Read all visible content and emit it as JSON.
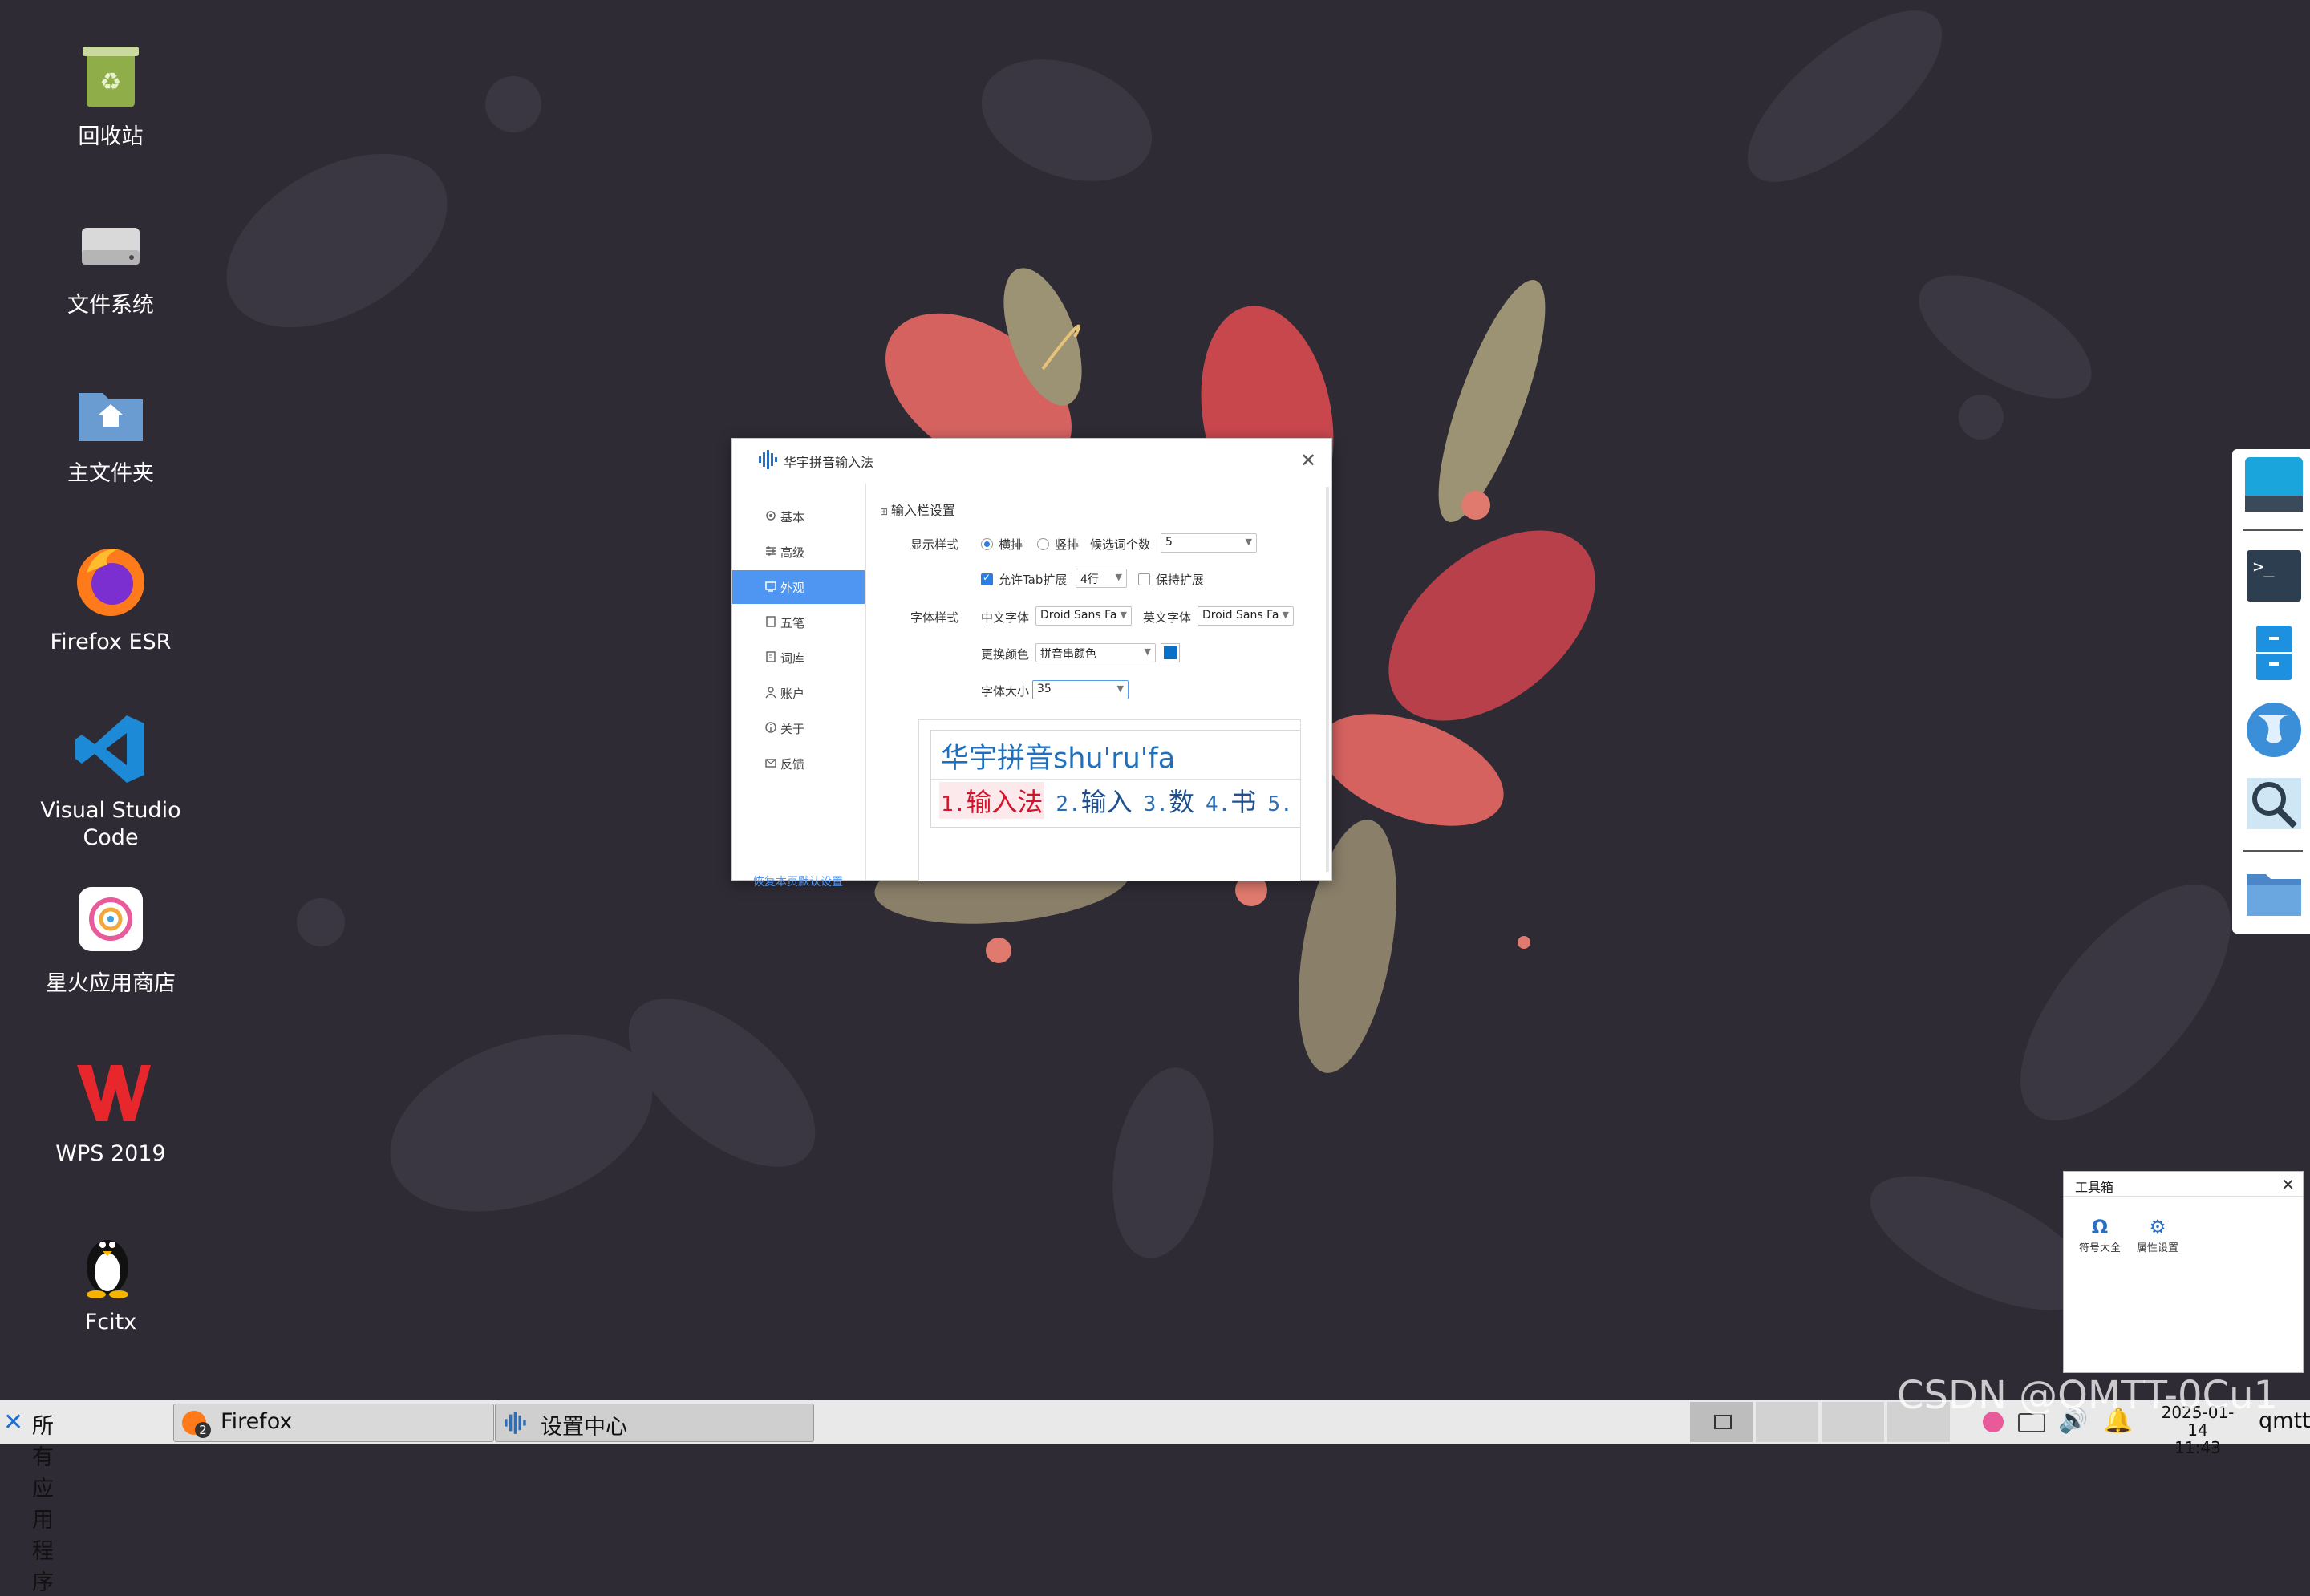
{
  "desktop": {
    "icons": [
      {
        "label": "回收站",
        "icon": "recycle-bin-icon"
      },
      {
        "label": "文件系统",
        "icon": "drive-icon"
      },
      {
        "label": "主文件夹",
        "icon": "home-folder-icon"
      },
      {
        "label": "Firefox ESR",
        "icon": "firefox-icon"
      },
      {
        "label": "Visual Studio Code",
        "icon": "vscode-icon"
      },
      {
        "label": "星火应用商店",
        "icon": "app-store-icon"
      },
      {
        "label": "WPS 2019",
        "icon": "wps-icon"
      },
      {
        "label": "Fcitx",
        "icon": "tux-icon"
      }
    ]
  },
  "dialog": {
    "title": "华宇拼音输入法",
    "close": "✕",
    "sidebar": {
      "items": [
        {
          "label": "基本",
          "icon": "gear-icon"
        },
        {
          "label": "高级",
          "icon": "sliders-icon"
        },
        {
          "label": "外观",
          "icon": "palette-icon",
          "active": true
        },
        {
          "label": "五笔",
          "icon": "pen-icon"
        },
        {
          "label": "词库",
          "icon": "book-icon"
        },
        {
          "label": "账户",
          "icon": "user-icon"
        },
        {
          "label": "关于",
          "icon": "info-icon"
        },
        {
          "label": "反馈",
          "icon": "mail-icon"
        }
      ],
      "reset": "恢复本页默认设置"
    },
    "section_title": "输入栏设置",
    "display_style": {
      "label": "显示样式",
      "horizontal": "横排",
      "vertical": "竖排",
      "candidate_count_label": "候选词个数",
      "candidate_count": "5"
    },
    "tab_expand": {
      "allow_label": "允许Tab扩展",
      "rows": "4行",
      "keep_label": "保持扩展"
    },
    "font_style": {
      "label": "字体样式",
      "cn_font_label": "中文字体",
      "cn_font": "Droid Sans Fa",
      "en_font_label": "英文字体",
      "en_font": "Droid Sans Fa",
      "color_label": "更换颜色",
      "color_target": "拼音串颜色",
      "color_value": "#0a6fc7",
      "size_label": "字体大小",
      "size": "35"
    },
    "preview": {
      "composition": "华宇拼音shu'ru'fa",
      "candidates": [
        {
          "num": "1.",
          "text": "输入法"
        },
        {
          "num": "2.",
          "text": "输入"
        },
        {
          "num": "3.",
          "text": "数"
        },
        {
          "num": "4.",
          "text": "书"
        },
        {
          "num": "5.",
          "text": ""
        }
      ]
    }
  },
  "dock": {
    "items": [
      "browser-icon",
      "terminal-icon",
      "file-cabinet-icon",
      "globe-icon",
      "search-icon",
      "folder-icon"
    ]
  },
  "toolbox": {
    "title": "工具箱",
    "close": "✕",
    "tools": [
      {
        "label": "符号大全",
        "glyph": "Ω"
      },
      {
        "label": "属性设置",
        "glyph": "⚙"
      }
    ]
  },
  "taskbar": {
    "menu": "所有应用程序",
    "tasks": [
      {
        "label": "Firefox",
        "badge": "2"
      },
      {
        "label": "设置中心"
      }
    ],
    "date": "2025-01-14",
    "time": "11:43",
    "user": "qmtt"
  },
  "watermark": "CSDN @QMTT-0Cu1"
}
